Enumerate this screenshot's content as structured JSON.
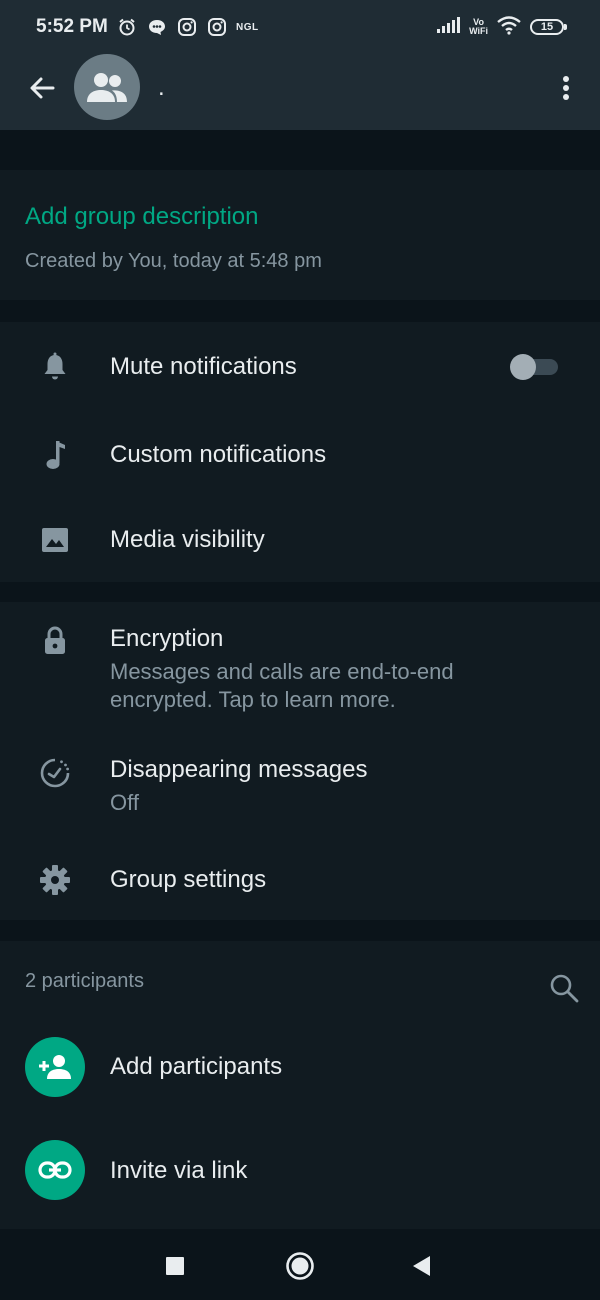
{
  "status_bar": {
    "time": "5:52 PM",
    "ngl": "NGL",
    "vowifi_top": "Vo",
    "vowifi_bottom": "WiFi",
    "battery": "15"
  },
  "header": {
    "group_name": ".",
    "icons": {
      "back": "arrow-left-icon",
      "avatar": "group-icon",
      "menu": "more-vertical-icon"
    }
  },
  "info": {
    "add_description": "Add group description",
    "created": "Created by You, today at 5:48 pm"
  },
  "notifications": {
    "mute": "Mute notifications",
    "mute_enabled": false,
    "custom": "Custom notifications",
    "media": "Media visibility"
  },
  "security": {
    "encryption_title": "Encryption",
    "encryption_sub": "Messages and calls are end-to-end encrypted. Tap to learn more.",
    "disappearing_title": "Disappearing messages",
    "disappearing_value": "Off",
    "group_settings": "Group settings"
  },
  "participants": {
    "count_label": "2 participants",
    "add": "Add participants",
    "invite": "Invite via link"
  },
  "colors": {
    "accent": "#00a884",
    "background": "#0b141a",
    "surface": "#111b21",
    "header": "#1f2c34"
  }
}
